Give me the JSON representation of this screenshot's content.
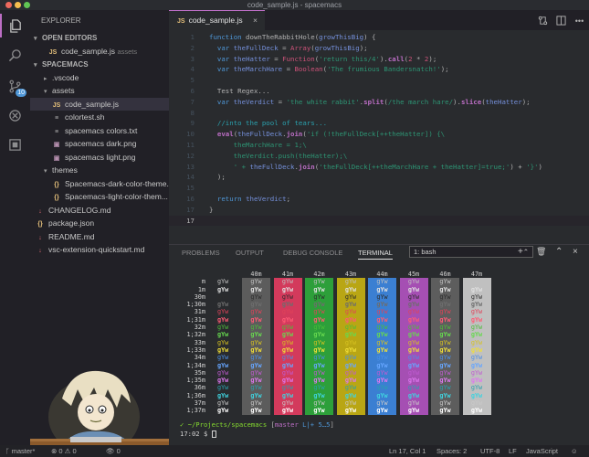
{
  "window": {
    "title": "code_sample.js - spacemacs"
  },
  "activity": {
    "scm_badge": "10"
  },
  "sidebar": {
    "header": "EXPLORER",
    "open_editors_label": "OPEN EDITORS",
    "open_editor": {
      "icon": "JS",
      "name": "code_sample.js",
      "folder": "assets"
    },
    "project_label": "SPACEMACS",
    "tree": [
      {
        "name": ".vscode",
        "depth": 1,
        "twisty": "▸",
        "icon": ""
      },
      {
        "name": "assets",
        "depth": 1,
        "twisty": "▾",
        "icon": ""
      },
      {
        "name": "code_sample.js",
        "depth": 2,
        "icon": "JS",
        "color": "#e5c07b",
        "selected": true
      },
      {
        "name": "colortest.sh",
        "depth": 2,
        "icon": "≡",
        "color": "#b2b2b2"
      },
      {
        "name": "spacemacs colors.txt",
        "depth": 2,
        "icon": "≡",
        "color": "#b2b2b2"
      },
      {
        "name": "spacemacs dark.png",
        "depth": 2,
        "icon": "▣",
        "color": "#b48ead"
      },
      {
        "name": "spacemacs light.png",
        "depth": 2,
        "icon": "▣",
        "color": "#b48ead"
      },
      {
        "name": "themes",
        "depth": 1,
        "twisty": "▾",
        "icon": ""
      },
      {
        "name": "Spacemacs-dark-color-theme...",
        "depth": 2,
        "icon": "{}",
        "color": "#e5c07b"
      },
      {
        "name": "Spacemacs-light-color-them...",
        "depth": 2,
        "icon": "{}",
        "color": "#e5c07b"
      },
      {
        "name": "CHANGELOG.md",
        "depth": 0,
        "icon": "↓",
        "color": "#e06c75"
      },
      {
        "name": "package.json",
        "depth": 0,
        "icon": "{}",
        "color": "#e5c07b"
      },
      {
        "name": "README.md",
        "depth": 0,
        "icon": "↓",
        "color": "#e06c75"
      },
      {
        "name": "vsc-extension-quickstart.md",
        "depth": 0,
        "icon": "↓",
        "color": "#e06c75"
      }
    ]
  },
  "editor": {
    "tab": {
      "icon": "JS",
      "name": "code_sample.js",
      "close": "×"
    },
    "lines": [
      {
        "n": "1",
        "tokens": [
          [
            "kw",
            "function "
          ],
          [
            "df",
            "downTheRabbitHole"
          ],
          [
            "df",
            "("
          ],
          [
            "vr",
            "growThisBig"
          ],
          [
            "df",
            ") {"
          ]
        ]
      },
      {
        "n": "2",
        "tokens": [
          [
            "df",
            "  "
          ],
          [
            "kw",
            "var "
          ],
          [
            "vr",
            "theFullDeck"
          ],
          [
            "df",
            " = "
          ],
          [
            "bt",
            "Array"
          ],
          [
            "df",
            "("
          ],
          [
            "vr",
            "growThisBig"
          ],
          [
            "df",
            ");"
          ]
        ]
      },
      {
        "n": "3",
        "tokens": [
          [
            "df",
            "  "
          ],
          [
            "kw",
            "var "
          ],
          [
            "vr",
            "theHatter"
          ],
          [
            "df",
            " = "
          ],
          [
            "bt",
            "Function"
          ],
          [
            "df",
            "("
          ],
          [
            "st",
            "'return this/4'"
          ],
          [
            "df",
            ")."
          ],
          [
            "fn",
            "call"
          ],
          [
            "df",
            "("
          ],
          [
            "bt",
            "2"
          ],
          [
            "df",
            " * "
          ],
          [
            "bt",
            "2"
          ],
          [
            "df",
            ");"
          ]
        ]
      },
      {
        "n": "4",
        "tokens": [
          [
            "df",
            "  "
          ],
          [
            "kw",
            "var "
          ],
          [
            "vr",
            "theMarchHare"
          ],
          [
            "df",
            " = "
          ],
          [
            "bt",
            "Boolean"
          ],
          [
            "df",
            "("
          ],
          [
            "st",
            "'The frumious Bandersnatch!'"
          ],
          [
            "df",
            ");"
          ]
        ]
      },
      {
        "n": "5",
        "tokens": []
      },
      {
        "n": "6",
        "tokens": [
          [
            "df",
            "  Test Regex..."
          ]
        ]
      },
      {
        "n": "7",
        "tokens": [
          [
            "df",
            "  "
          ],
          [
            "kw",
            "var "
          ],
          [
            "vr",
            "theVerdict"
          ],
          [
            "df",
            " = "
          ],
          [
            "st",
            "'the white rabbit'"
          ],
          [
            "df",
            "."
          ],
          [
            "fn",
            "split"
          ],
          [
            "df",
            "("
          ],
          [
            "st",
            "/the march hare/"
          ],
          [
            "df",
            ")."
          ],
          [
            "fn",
            "slice"
          ],
          [
            "df",
            "("
          ],
          [
            "vr",
            "theHatter"
          ],
          [
            "df",
            ");"
          ]
        ]
      },
      {
        "n": "8",
        "tokens": []
      },
      {
        "n": "9",
        "tokens": [
          [
            "df",
            "  "
          ],
          [
            "cm",
            "//into the pool of tears..."
          ]
        ]
      },
      {
        "n": "10",
        "tokens": [
          [
            "df",
            "  "
          ],
          [
            "fn",
            "eval"
          ],
          [
            "df",
            "("
          ],
          [
            "vr",
            "theFullDeck"
          ],
          [
            "df",
            "."
          ],
          [
            "fn",
            "join"
          ],
          [
            "df",
            "("
          ],
          [
            "st",
            "'if (!theFullDeck[++theHatter]) {\\"
          ]
        ]
      },
      {
        "n": "11",
        "tokens": [
          [
            "st",
            "      theMarchHare = 1;\\"
          ]
        ]
      },
      {
        "n": "12",
        "tokens": [
          [
            "st",
            "      theVerdict.push(theHatter);\\"
          ]
        ]
      },
      {
        "n": "13",
        "tokens": [
          [
            "st",
            "      ' + "
          ],
          [
            "vr",
            "theFullDeck"
          ],
          [
            "df",
            "."
          ],
          [
            "fn",
            "join"
          ],
          [
            "df",
            "("
          ],
          [
            "st",
            "'theFullDeck[++theMarchHare + theHatter]=true;'"
          ],
          [
            "df",
            ") + "
          ],
          [
            "st",
            "'}'"
          ],
          [
            "df",
            ")"
          ]
        ]
      },
      {
        "n": "14",
        "tokens": [
          [
            "df",
            "  );"
          ]
        ]
      },
      {
        "n": "15",
        "tokens": []
      },
      {
        "n": "16",
        "tokens": [
          [
            "df",
            "  "
          ],
          [
            "kw",
            "return "
          ],
          [
            "vr",
            "theVerdict"
          ],
          [
            "df",
            ";"
          ]
        ]
      },
      {
        "n": "17",
        "tokens": [
          [
            "df",
            "}"
          ]
        ]
      },
      {
        "n": "17",
        "tokens": [],
        "current": true
      }
    ]
  },
  "panel": {
    "tabs": [
      "PROBLEMS",
      "OUTPUT",
      "DEBUG CONSOLE",
      "TERMINAL"
    ],
    "active_tab": "TERMINAL",
    "terminal_select": "1: bash",
    "terminal": {
      "bg_headers": [
        "40m",
        "41m",
        "42m",
        "43m",
        "44m",
        "45m",
        "46m",
        "47m"
      ],
      "bg_colors": [
        "#5c5c5c",
        "#d33a5c",
        "#2d9f3a",
        "#b9a614",
        "#3b7fd2",
        "#a54fb3",
        "#5d5d5d",
        "#c0c0c0"
      ],
      "rows": [
        {
          "label": "m",
          "fg": "#c0c0c0",
          "bold": false
        },
        {
          "label": "1m",
          "fg": "#e0e0e0",
          "bold": true
        },
        {
          "label": "30m",
          "fg": "#2d2d2d",
          "bold": false
        },
        {
          "label": "1;30m",
          "fg": "#6d6d6d",
          "bold": true
        },
        {
          "label": "31m",
          "fg": "#e0435a",
          "bold": false
        },
        {
          "label": "1;31m",
          "fg": "#ff5b75",
          "bold": true
        },
        {
          "label": "32m",
          "fg": "#4dbd3a",
          "bold": false
        },
        {
          "label": "1;32m",
          "fg": "#67d94f",
          "bold": true
        },
        {
          "label": "33m",
          "fg": "#d6c221",
          "bold": false
        },
        {
          "label": "1;33m",
          "fg": "#f0de38",
          "bold": true
        },
        {
          "label": "34m",
          "fg": "#4b8fe6",
          "bold": false
        },
        {
          "label": "1;34m",
          "fg": "#66a6ff",
          "bold": true
        },
        {
          "label": "35m",
          "fg": "#c05bd2",
          "bold": false
        },
        {
          "label": "1;35m",
          "fg": "#dd77ee",
          "bold": true
        },
        {
          "label": "36m",
          "fg": "#2aa1ae",
          "bold": false
        },
        {
          "label": "1;36m",
          "fg": "#3fd3df",
          "bold": true
        },
        {
          "label": "37m",
          "fg": "#c9c9c9",
          "bold": false
        },
        {
          "label": "1;37m",
          "fg": "#ffffff",
          "bold": true
        }
      ],
      "cell_text": "gYw",
      "prompt_line": {
        "check": "✓",
        "path": "~/Projects/spacemacs",
        "branch_open": "[",
        "branch": "master",
        "status": "L|+ 5…5",
        "branch_close": "]"
      },
      "prompt2": {
        "time": "17:02",
        "sign": "$"
      }
    }
  },
  "statusbar": {
    "branch": "master*",
    "errors": "0",
    "warnings": "0",
    "views": "0",
    "position": "Ln 17, Col 1",
    "spaces": "Spaces: 2",
    "encoding": "UTF-8",
    "eol": "LF",
    "language": "JavaScript"
  }
}
